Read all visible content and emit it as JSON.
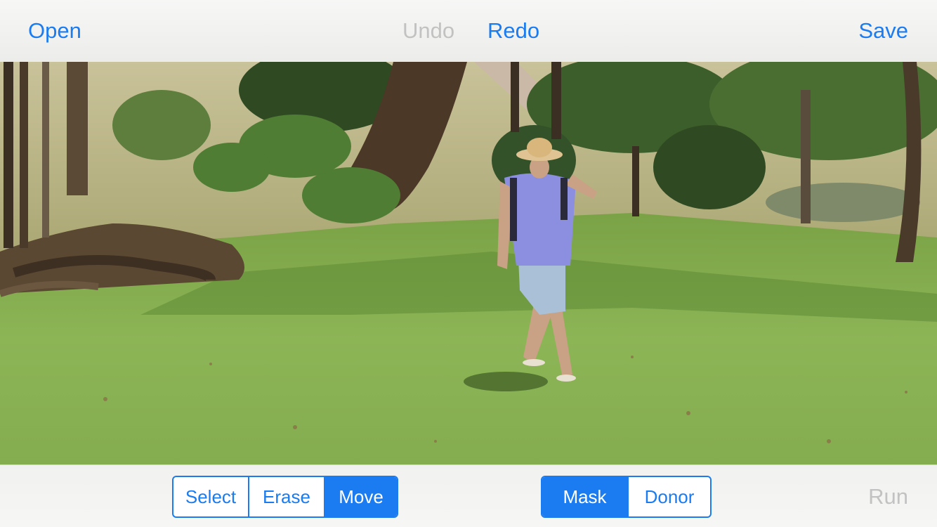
{
  "toolbar": {
    "open_label": "Open",
    "undo_label": "Undo",
    "redo_label": "Redo",
    "save_label": "Save"
  },
  "tools": {
    "items": [
      {
        "label": "Select",
        "active": false
      },
      {
        "label": "Erase",
        "active": false
      },
      {
        "label": "Move",
        "active": true
      }
    ]
  },
  "layers": {
    "items": [
      {
        "label": "Mask",
        "active": true
      },
      {
        "label": "Donor",
        "active": false
      }
    ]
  },
  "run_label": "Run",
  "colors": {
    "accent": "#1a7cf0",
    "disabled": "#c2c2c2",
    "toolbar_bg": "#f2f2f0"
  }
}
